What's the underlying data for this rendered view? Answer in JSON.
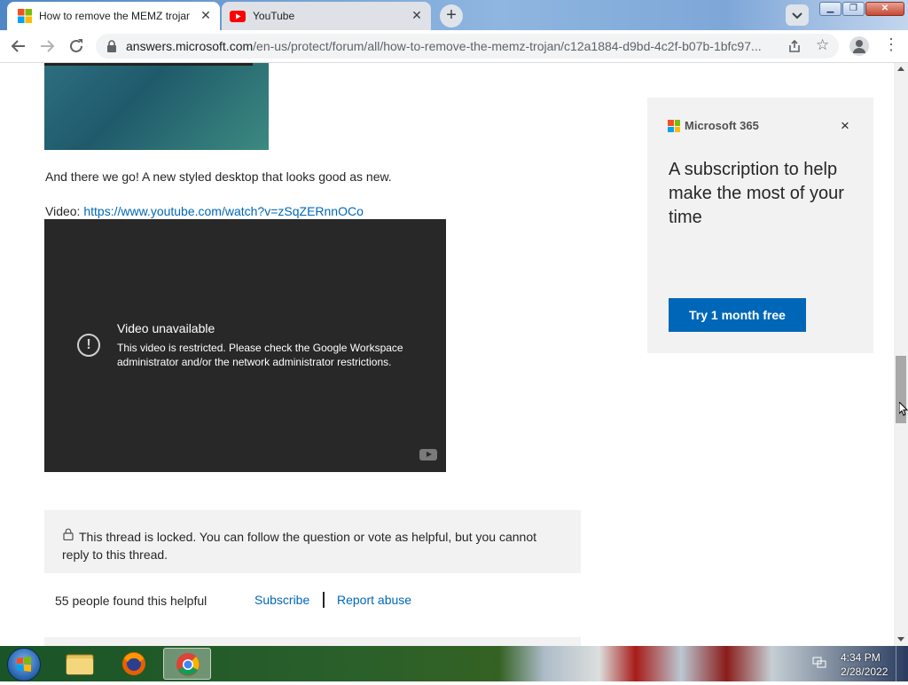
{
  "browser": {
    "tabs": [
      {
        "title": "How to remove the MEMZ trojan",
        "favicon": "microsoft-logo",
        "active": true
      },
      {
        "title": "YouTube",
        "favicon": "youtube-logo",
        "active": false
      }
    ],
    "new_tab_label": "+",
    "url_host": "answers.microsoft.com",
    "url_path": "/en-us/protect/forum/all/how-to-remove-the-memz-trojan/c12a1884-d9bd-4c2f-b07b-1bfc97..."
  },
  "article": {
    "paragraph": "And there we go! A new styled desktop that looks good as new.",
    "video_prefix": "Video: ",
    "video_link": "https://www.youtube.com/watch?v=zSqZERnnOCo",
    "video_player": {
      "title": "Video unavailable",
      "message": "This video is restricted. Please check the Google Workspace administrator and/or the network administrator restrictions."
    },
    "locked_notice": "This thread is locked. You can follow the question or vote as helpful, but you cannot reply to this thread.",
    "helpful_count": "55 people found this helpful",
    "subscribe_label": "Subscribe",
    "separator": "|",
    "report_label": "Report abuse"
  },
  "ad": {
    "brand": "Microsoft 365",
    "headline": "A subscription to help make the most of your time",
    "cta": "Try 1 month free",
    "close_label": "×"
  },
  "taskbar": {
    "apps": [
      "windows-explorer",
      "firefox",
      "google-chrome"
    ],
    "time": "4:34 PM",
    "date": "2/28/2022"
  },
  "colors": {
    "link": "#0067b8",
    "cta_bg": "#0067b8",
    "video_bg": "#282828",
    "notice_bg": "#f2f2f2"
  }
}
